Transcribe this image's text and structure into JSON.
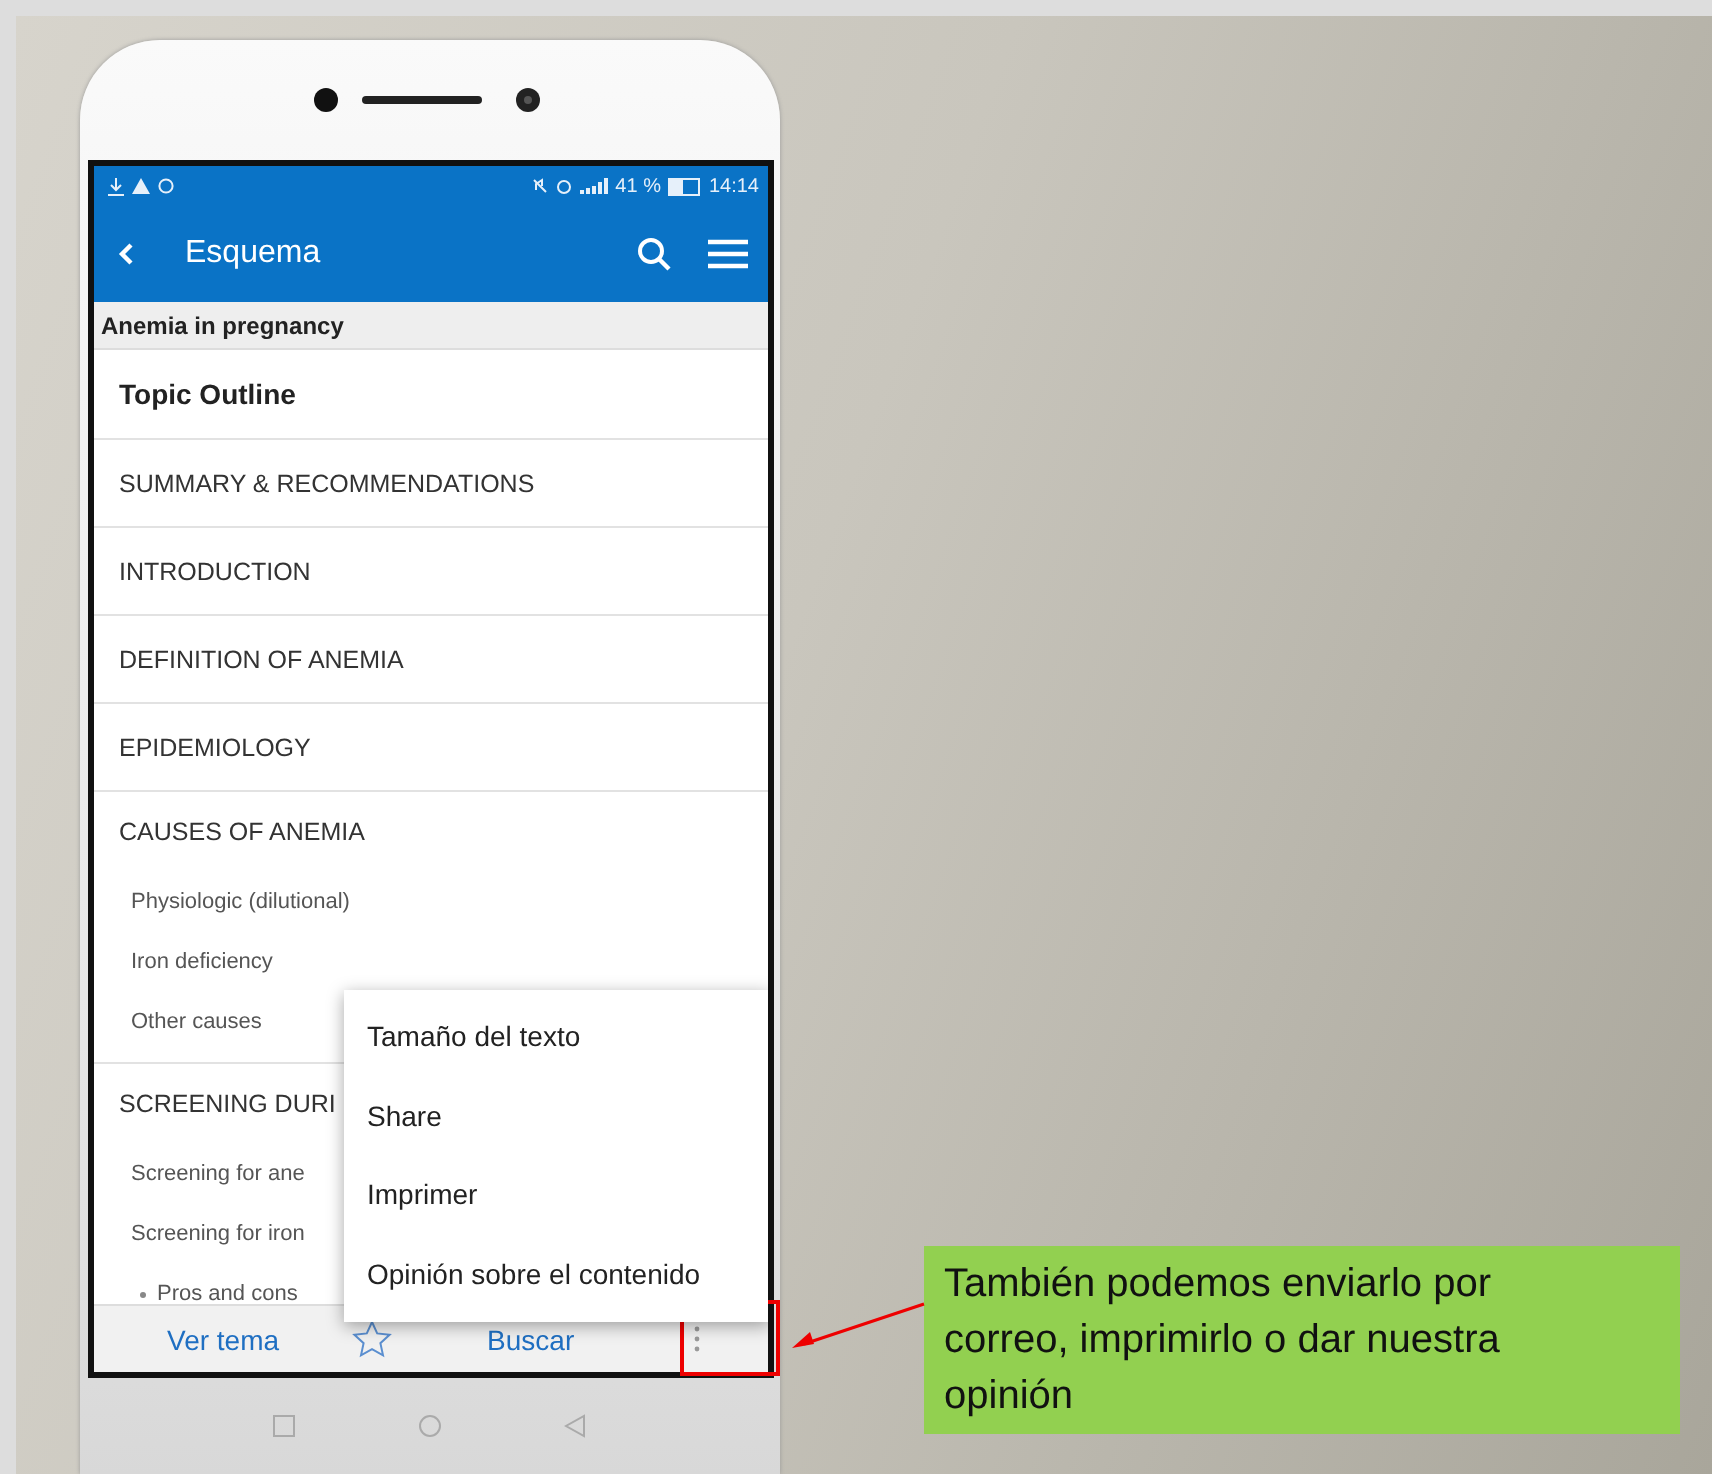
{
  "status_bar": {
    "battery": "41 %",
    "time": "14:14"
  },
  "app_bar": {
    "title": "Esquema"
  },
  "topic": {
    "title": "Anemia in pregnancy"
  },
  "outline": {
    "title": "Topic Outline",
    "items": [
      {
        "label": "SUMMARY & RECOMMENDATIONS"
      },
      {
        "label": "INTRODUCTION"
      },
      {
        "label": "DEFINITION OF ANEMIA"
      },
      {
        "label": "EPIDEMIOLOGY"
      },
      {
        "label": "CAUSES OF ANEMIA",
        "children": [
          {
            "label": "Physiologic (dilutional)"
          },
          {
            "label": "Iron deficiency"
          },
          {
            "label": "Other causes"
          }
        ]
      },
      {
        "label": "SCREENING DURI",
        "children": [
          {
            "label": "Screening for ane"
          },
          {
            "label": "Screening for iron",
            "children": [
              {
                "label": "Pros and cons"
              }
            ]
          }
        ]
      }
    ]
  },
  "menu": {
    "items": [
      "Tamaño del texto",
      "Share",
      "Imprimer",
      "Opinión sobre el contenido"
    ]
  },
  "bottom_bar": {
    "left": "Ver tema",
    "right": "Buscar"
  },
  "callout": {
    "text": "También podemos enviarlo por correo, imprimirlo o dar nuestra opinión"
  }
}
